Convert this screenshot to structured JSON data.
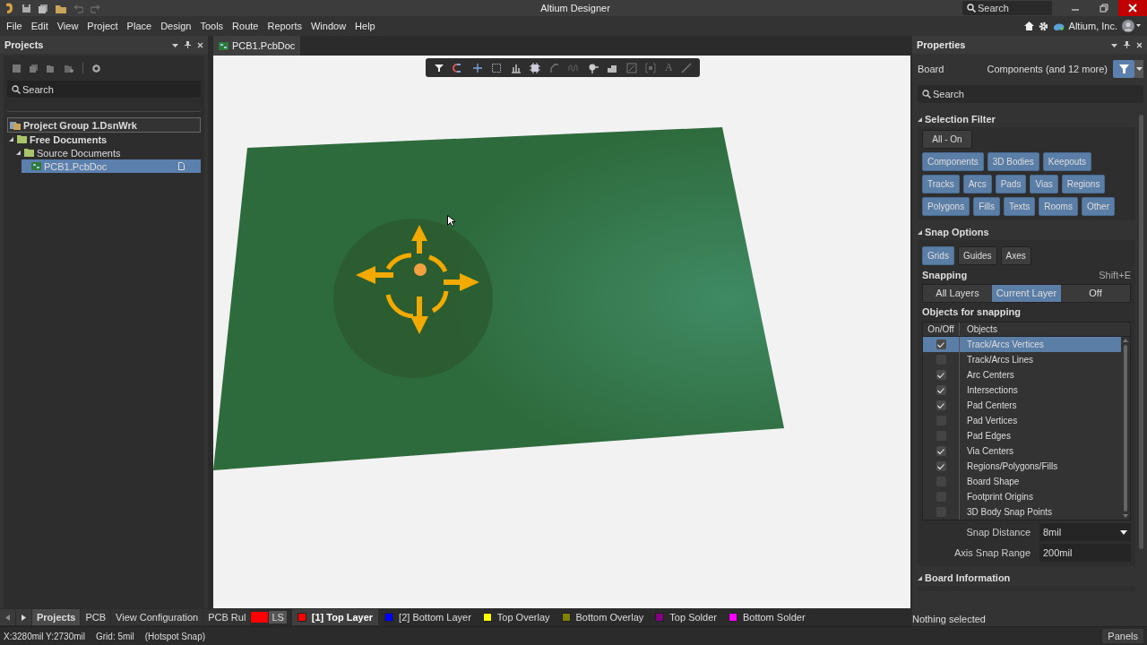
{
  "title_bar": {
    "title": "Altium Designer",
    "search_placeholder": "Search"
  },
  "menu": [
    "File",
    "Edit",
    "View",
    "Project",
    "Place",
    "Design",
    "Tools",
    "Route",
    "Reports",
    "Window",
    "Help"
  ],
  "account": {
    "name": "Altium, Inc."
  },
  "projects_panel": {
    "title": "Projects",
    "search_placeholder": "Search",
    "tree": [
      {
        "label": "Project Group 1.DsnWrk",
        "kind": "group",
        "selected": false
      },
      {
        "label": "Free Documents",
        "kind": "folder",
        "selected": false,
        "expanded": true,
        "children": [
          {
            "label": "Source Documents",
            "kind": "folder",
            "selected": false,
            "expanded": true,
            "children": [
              {
                "label": "PCB1.PcbDoc",
                "kind": "pcb",
                "selected": true
              }
            ]
          }
        ]
      }
    ]
  },
  "document_tabs": [
    {
      "label": "PCB1.PcbDoc",
      "selected": true
    }
  ],
  "canvas_toolbar": [
    {
      "kind": "filter"
    },
    {
      "kind": "magnet"
    },
    {
      "kind": "cross"
    },
    {
      "kind": "select"
    },
    {
      "kind": "bars"
    },
    {
      "kind": "chip"
    },
    {
      "kind": "route"
    },
    {
      "kind": "wave"
    },
    {
      "kind": "pin"
    },
    {
      "kind": "steps"
    },
    {
      "kind": "diagonal"
    },
    {
      "kind": "bracket"
    },
    {
      "kind": "text",
      "label": "A"
    },
    {
      "kind": "line"
    }
  ],
  "properties": {
    "title": "Properties",
    "board_label": "Board",
    "filter_summary": "Components (and 12 more)",
    "search_placeholder": "Search",
    "selection_filter": {
      "title": "Selection Filter",
      "all_button": "All - On",
      "buttons": [
        {
          "label": "Components",
          "selected": true
        },
        {
          "label": "3D Bodies",
          "selected": true
        },
        {
          "label": "Keepouts",
          "selected": true
        },
        {
          "label": "Tracks",
          "selected": true
        },
        {
          "label": "Arcs",
          "selected": true
        },
        {
          "label": "Pads",
          "selected": true
        },
        {
          "label": "Vias",
          "selected": true
        },
        {
          "label": "Regions",
          "selected": true
        },
        {
          "label": "Polygons",
          "selected": true
        },
        {
          "label": "Fills",
          "selected": true
        },
        {
          "label": "Texts",
          "selected": true
        },
        {
          "label": "Rooms",
          "selected": true
        },
        {
          "label": "Other",
          "selected": true
        }
      ]
    },
    "snap_options": {
      "title": "Snap Options",
      "modes": [
        {
          "label": "Grids",
          "selected": true
        },
        {
          "label": "Guides",
          "selected": false
        },
        {
          "label": "Axes",
          "selected": false
        }
      ],
      "snapping_label": "Snapping",
      "shortcut": "Shift+E",
      "snapping": [
        {
          "label": "All Layers",
          "selected": false
        },
        {
          "label": "Current Layer",
          "selected": true
        },
        {
          "label": "Off",
          "selected": false
        }
      ],
      "objects_label": "Objects for snapping",
      "columns": [
        "On/Off",
        "Objects"
      ],
      "rows": [
        {
          "label": "Track/Arcs Vertices",
          "checked": true,
          "selected": true
        },
        {
          "label": "Track/Arcs Lines",
          "checked": false,
          "selected": false
        },
        {
          "label": "Arc Centers",
          "checked": true,
          "selected": false
        },
        {
          "label": "Intersections",
          "checked": true,
          "selected": false
        },
        {
          "label": "Pad Centers",
          "checked": true,
          "selected": false
        },
        {
          "label": "Pad Vertices",
          "checked": false,
          "selected": false
        },
        {
          "label": "Pad Edges",
          "checked": false,
          "selected": false
        },
        {
          "label": "Via Centers",
          "checked": true,
          "selected": false
        },
        {
          "label": "Regions/Polygons/Fills",
          "checked": true,
          "selected": false
        },
        {
          "label": "Board Shape",
          "checked": false,
          "selected": false
        },
        {
          "label": "Footprint Origins",
          "checked": false,
          "selected": false
        },
        {
          "label": "3D Body Snap Points",
          "checked": false,
          "selected": false
        }
      ],
      "snap_distance": {
        "label": "Snap Distance",
        "value": "8mil"
      },
      "axis_snap_range": {
        "label": "Axis Snap Range",
        "value": "200mil"
      }
    },
    "board_information": {
      "title": "Board Information"
    },
    "status": "Nothing selected"
  },
  "panel_tabs": [
    {
      "label": "Projects",
      "selected": true
    },
    {
      "label": "PCB",
      "selected": false
    },
    {
      "label": "View Configuration",
      "selected": false
    },
    {
      "label": "PCB Rul",
      "selected": false
    }
  ],
  "current_layer": {
    "color": "#ff0000",
    "label": "LS"
  },
  "layer_tabs": [
    {
      "label": "[1] Top Layer",
      "color": "#ff0000",
      "selected": true
    },
    {
      "label": "[2] Bottom Layer",
      "color": "#0000ff",
      "selected": false
    },
    {
      "label": "Top Overlay",
      "color": "#ffff00",
      "selected": false
    },
    {
      "label": "Bottom Overlay",
      "color": "#808000",
      "selected": false
    },
    {
      "label": "Top Solder",
      "color": "#800080",
      "selected": false
    },
    {
      "label": "Bottom Solder",
      "color": "#ff00ff",
      "selected": false
    }
  ],
  "status_bar": [
    "X:3280mil Y:2730mil",
    "Grid: 5mil",
    "(Hotspot Snap)"
  ],
  "panels_button": "Panels"
}
